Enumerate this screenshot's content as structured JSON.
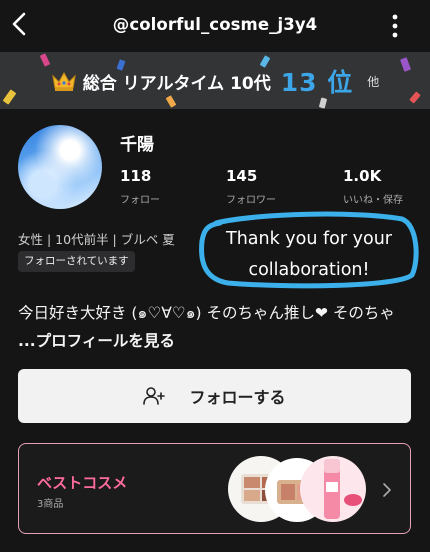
{
  "header": {
    "username": "@colorful_cosme_j3y4",
    "back_icon": "back-icon",
    "menu_icon": "kebab-icon"
  },
  "ranking": {
    "icon": "crown-icon",
    "label": "総合 リアルタイム 10代",
    "value": "13 位",
    "other": "他"
  },
  "profile": {
    "name": "千陽",
    "stats": [
      {
        "value": "118",
        "label": "フォロー"
      },
      {
        "value": "145",
        "label": "フォロワー"
      },
      {
        "value": "1.0K",
        "label": "いいね・保存"
      }
    ],
    "meta": "女性 | 10代前半 | ブルベ 夏",
    "follows_you": "フォローされています",
    "bio": "今日好き大好き (๑♡∀♡๑) そのちゃん推し❤ そのちゃ ",
    "bio_more": "...プロフィールを見る"
  },
  "annotation": {
    "line1": "Thank you for your",
    "line2": "collaboration!",
    "ring_color": "#3cb0ea"
  },
  "actions": {
    "follow_label": "フォローする",
    "follow_icon": "add-user-icon"
  },
  "best_cosme": {
    "title": "ベストコスメ",
    "count": "3商品",
    "accent": "#ff6b9a"
  }
}
